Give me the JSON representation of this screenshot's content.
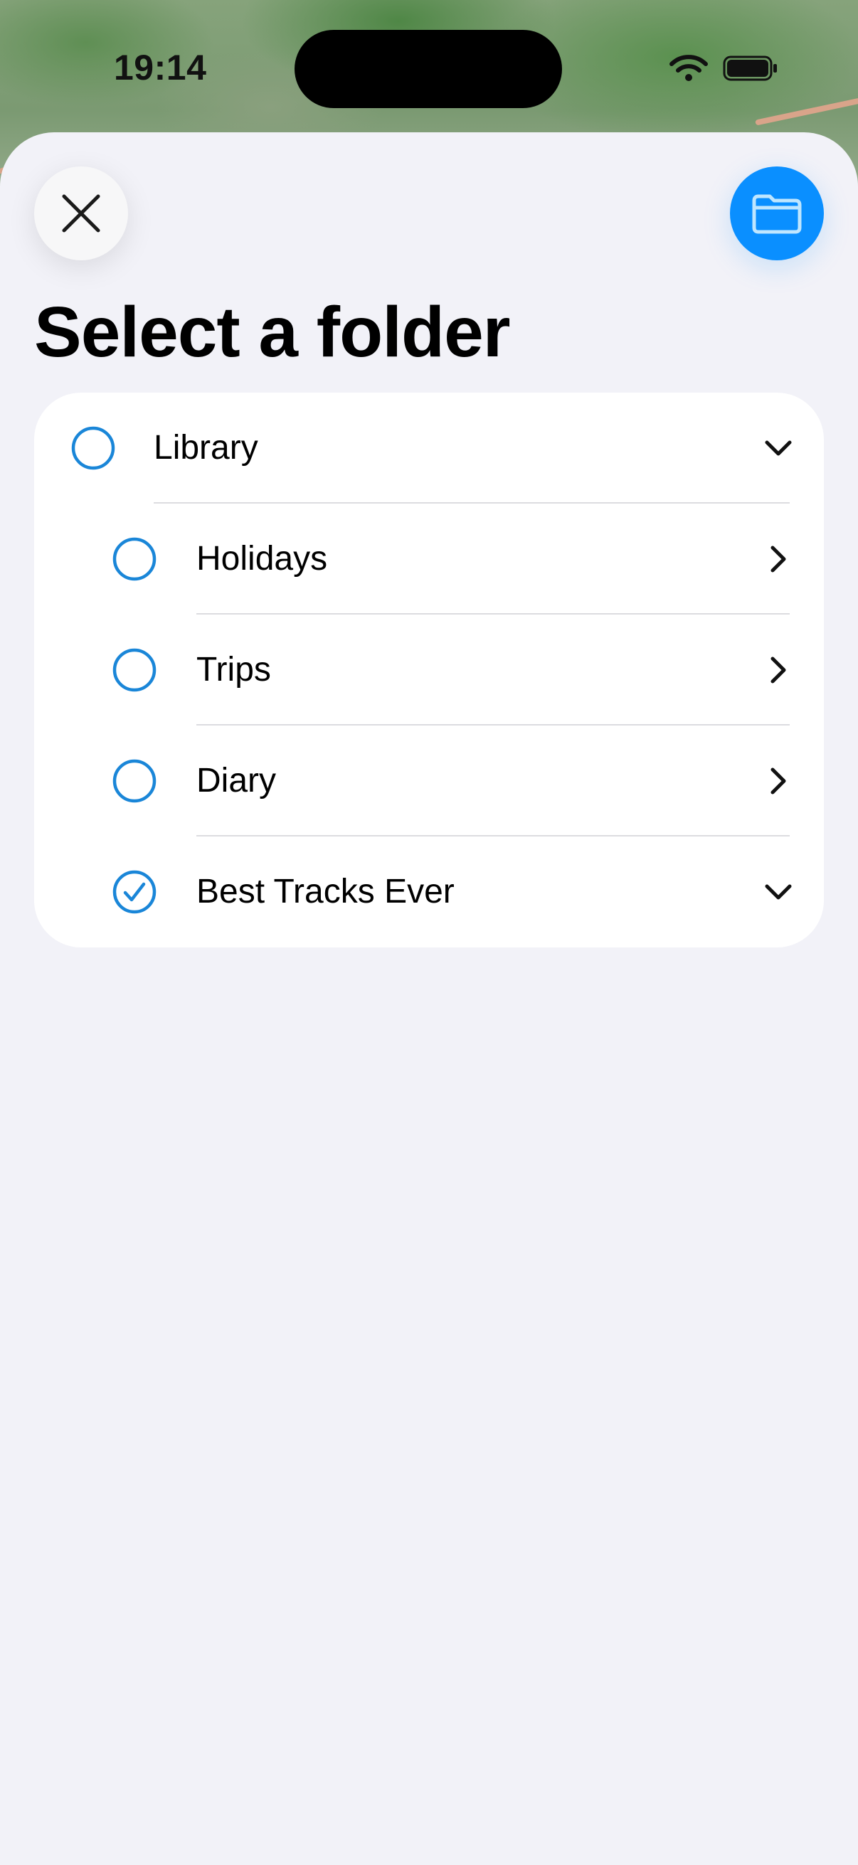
{
  "status_bar": {
    "time": "19:14",
    "icons": [
      "wifi-icon",
      "battery-icon"
    ]
  },
  "header": {
    "title": "Select a folder",
    "close_icon": "close-icon",
    "folder_icon": "folder-icon"
  },
  "folders": [
    {
      "label": "Library",
      "level": 0,
      "selected": false,
      "disclosure": "expanded"
    },
    {
      "label": "Holidays",
      "level": 1,
      "selected": false,
      "disclosure": "collapsed"
    },
    {
      "label": "Trips",
      "level": 1,
      "selected": false,
      "disclosure": "collapsed"
    },
    {
      "label": "Diary",
      "level": 1,
      "selected": false,
      "disclosure": "collapsed"
    },
    {
      "label": "Best Tracks Ever",
      "level": 1,
      "selected": true,
      "disclosure": "expanded"
    }
  ],
  "colors": {
    "accent": "#0a8fff",
    "radio": "#1a86d8",
    "sheet_background": "#f2f2f8",
    "card_background": "#ffffff"
  }
}
